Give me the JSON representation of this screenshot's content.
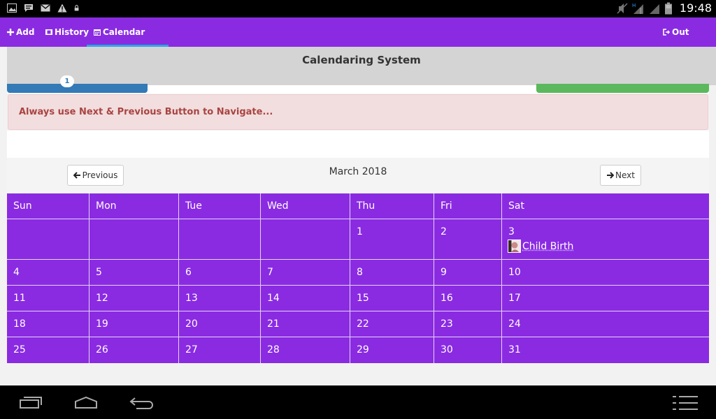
{
  "status_bar": {
    "time": "19:48",
    "icons_left": [
      "image-icon",
      "message-icon",
      "mail-icon",
      "warning-icon",
      "lock-icon"
    ],
    "icons_right": [
      "mute-icon",
      "signal-h-icon",
      "signal-icon",
      "battery-icon"
    ]
  },
  "navbar": {
    "add_label": "Add",
    "history_label": "History",
    "calendar_label": "Calendar",
    "out_label": "Out"
  },
  "header": {
    "title": "Calendaring System",
    "badge": "1"
  },
  "alert": {
    "text": "Always use Next & Previous Button to Navigate..."
  },
  "calendar": {
    "month_title": "March 2018",
    "prev_label": "Previous",
    "next_label": "Next",
    "weekdays": [
      "Sun",
      "Mon",
      "Tue",
      "Wed",
      "Thu",
      "Fri",
      "Sat"
    ],
    "weeks": [
      [
        "",
        "",
        "",
        "",
        "1",
        "2",
        "3"
      ],
      [
        "4",
        "5",
        "6",
        "7",
        "8",
        "9",
        "10"
      ],
      [
        "11",
        "12",
        "13",
        "14",
        "15",
        "16",
        "17"
      ],
      [
        "18",
        "19",
        "20",
        "21",
        "22",
        "23",
        "24"
      ],
      [
        "25",
        "26",
        "27",
        "28",
        "29",
        "30",
        "31"
      ]
    ],
    "event": {
      "label": "Child Birth",
      "day": "3"
    }
  },
  "colors": {
    "brand": "#8a2be2",
    "active_tab": "#2aa8e6",
    "alert_text": "#a94442",
    "alert_bg": "#f2dede"
  }
}
